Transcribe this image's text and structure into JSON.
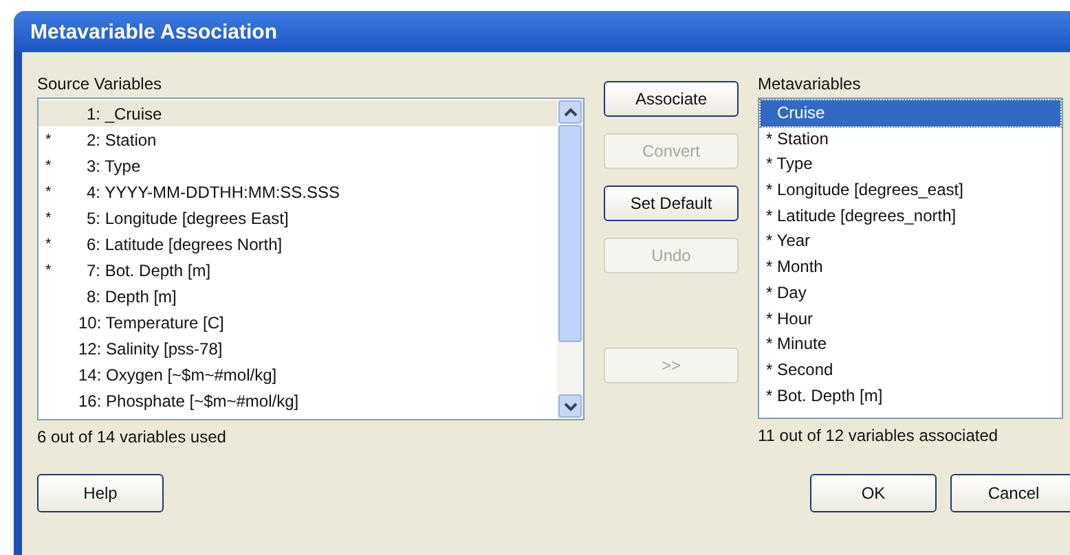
{
  "window": {
    "title": "Metavariable Association"
  },
  "source": {
    "label": "Source Variables",
    "status": "6 out of 14 variables used",
    "items": [
      {
        "text": "1: _Cruise",
        "used": false,
        "selected": true
      },
      {
        "text": "2: Station",
        "used": true,
        "selected": false
      },
      {
        "text": "3: Type",
        "used": true,
        "selected": false
      },
      {
        "text": "4: YYYY-MM-DDTHH:MM:SS.SSS",
        "used": true,
        "selected": false
      },
      {
        "text": "5: Longitude [degrees East]",
        "used": true,
        "selected": false
      },
      {
        "text": "6: Latitude [degrees North]",
        "used": true,
        "selected": false
      },
      {
        "text": "7: Bot. Depth [m]",
        "used": true,
        "selected": false
      },
      {
        "text": "8: Depth [m]",
        "used": false,
        "selected": false
      },
      {
        "text": "10: Temperature [C]",
        "used": false,
        "selected": false
      },
      {
        "text": "12: Salinity [pss-78]",
        "used": false,
        "selected": false
      },
      {
        "text": "14: Oxygen [~$m~#mol/kg]",
        "used": false,
        "selected": false
      },
      {
        "text": "16: Phosphate [~$m~#mol/kg]",
        "used": false,
        "selected": false
      }
    ]
  },
  "actions": [
    {
      "label": "Associate",
      "disabled": false
    },
    {
      "label": "Convert",
      "disabled": true
    },
    {
      "label": "Set Default",
      "disabled": false
    },
    {
      "label": "Undo",
      "disabled": true
    },
    {
      "label": ">>",
      "disabled": true
    }
  ],
  "meta": {
    "label": "Metavariables",
    "status": "11 out of 12 variables associated",
    "items": [
      {
        "text": "Cruise",
        "selected": true
      },
      {
        "text": "* Station",
        "selected": false
      },
      {
        "text": "* Type",
        "selected": false
      },
      {
        "text": "* Longitude [degrees_east]",
        "selected": false
      },
      {
        "text": "* Latitude [degrees_north]",
        "selected": false
      },
      {
        "text": "* Year",
        "selected": false
      },
      {
        "text": "* Month",
        "selected": false
      },
      {
        "text": "* Day",
        "selected": false
      },
      {
        "text": "* Hour",
        "selected": false
      },
      {
        "text": "* Minute",
        "selected": false
      },
      {
        "text": "* Second",
        "selected": false
      },
      {
        "text": "* Bot. Depth [m]",
        "selected": false
      }
    ]
  },
  "footer": {
    "help": "Help",
    "ok": "OK",
    "cancel": "Cancel",
    "mark": "*"
  }
}
